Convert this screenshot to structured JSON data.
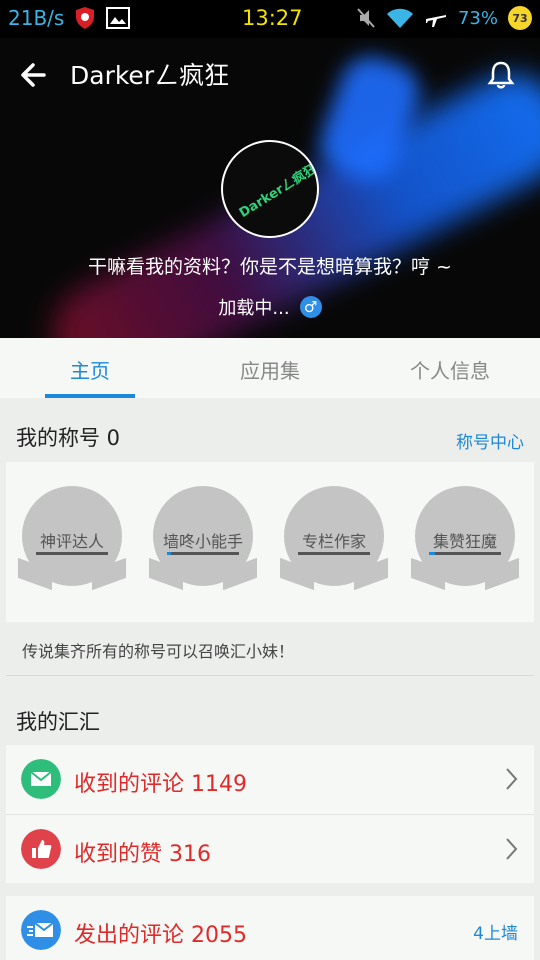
{
  "status_bar": {
    "net_speed": "21B/s",
    "time": "13:27",
    "battery": "73%",
    "badge": "73",
    "icons": [
      "shield-icon",
      "image-icon",
      "mute-icon",
      "wifi-icon",
      "airplane-icon"
    ]
  },
  "header": {
    "title": "Darkerㄥ疯狂",
    "avatar_text": "Darkerㄥ疯狂",
    "bio": "干嘛看我的资料？你是不是想暗算我？哼 ~",
    "loading": "加载中...",
    "gender_symbol": "♂",
    "colors": {
      "accent": "#1e88d8",
      "avatar_text": "#2fd27c"
    }
  },
  "tabs": [
    {
      "label": "主页",
      "active": true
    },
    {
      "label": "应用集",
      "active": false
    },
    {
      "label": "个人信息",
      "active": false
    }
  ],
  "titles_section": {
    "heading": "我的称号 0",
    "link": "称号中心",
    "medals": [
      {
        "label": "神评达人",
        "progress": 0.0
      },
      {
        "label": "墙咚小能手",
        "progress": 0.05
      },
      {
        "label": "专栏作家",
        "progress": 0.0
      },
      {
        "label": "集赞狂魔",
        "progress": 0.08
      }
    ],
    "note": "传说集齐所有的称号可以召唤汇小妹！"
  },
  "huihui_section": {
    "heading": "我的汇汇",
    "rows": [
      {
        "label": "收到的评论 1149",
        "icon": "mail-icon",
        "color": "#2ebd7a"
      },
      {
        "label": "收到的赞 316",
        "icon": "thumbs-up-icon",
        "color": "#e0424b"
      }
    ]
  },
  "sent_section": {
    "rows": [
      {
        "label": "发出的评论 2055",
        "icon": "send-mail-icon",
        "color": "#2f8ee5",
        "extra": "4上墙"
      }
    ]
  }
}
